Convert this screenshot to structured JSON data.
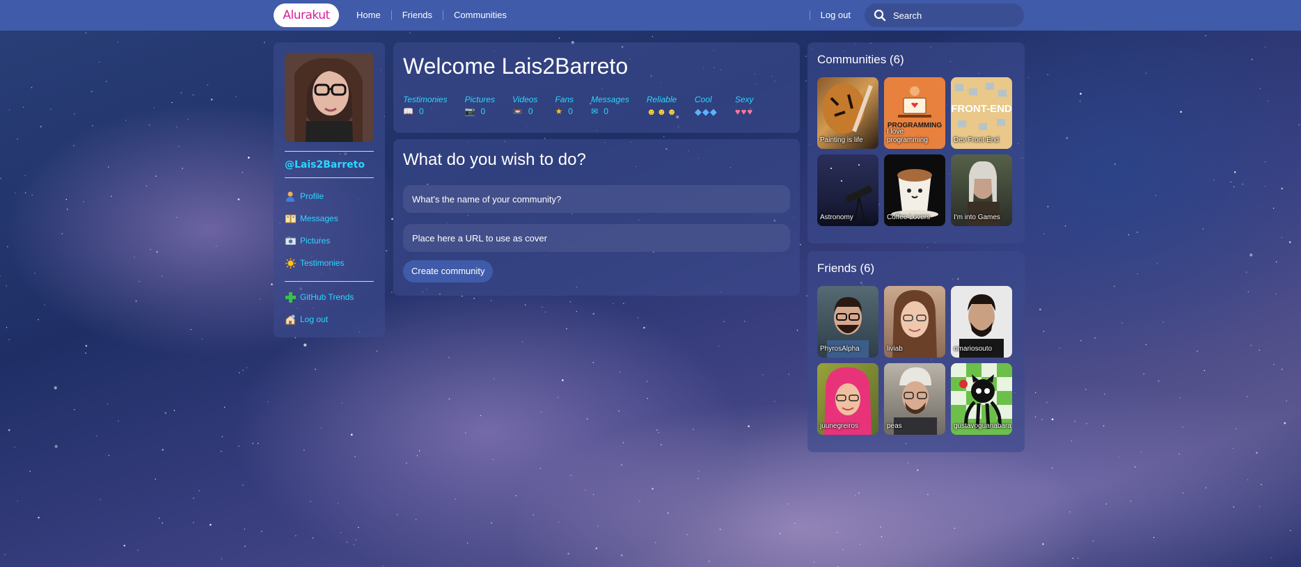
{
  "brand": {
    "logo_text": "Alurakut",
    "logo_color": "#d81d99",
    "bar_color": "#3f5ba9",
    "accent": "#2ad9ff"
  },
  "nav": {
    "home": "Home",
    "friends": "Friends",
    "communities": "Communities",
    "logout": "Log out"
  },
  "search": {
    "placeholder": "Search"
  },
  "sidebar": {
    "username": "@Lais2Barreto",
    "items": [
      {
        "label": "Profile",
        "icon": "user-icon"
      },
      {
        "label": "Messages",
        "icon": "book-icon"
      },
      {
        "label": "Pictures",
        "icon": "camera-icon"
      },
      {
        "label": "Testimonies",
        "icon": "sun-icon"
      }
    ],
    "extra": [
      {
        "label": "GitHub Trends",
        "icon": "plus-icon"
      },
      {
        "label": "Log out",
        "icon": "logout-icon"
      }
    ]
  },
  "welcome": {
    "title": "Welcome Lais2Barreto",
    "stats": [
      {
        "label": "Testimonies",
        "value": "0",
        "icon": "book-icon"
      },
      {
        "label": "Pictures",
        "value": "0",
        "icon": "camera-icon"
      },
      {
        "label": "Videos",
        "value": "0",
        "icon": "video-icon"
      },
      {
        "label": "Fans",
        "value": "0",
        "icon": "star-icon"
      },
      {
        "label": "Messages",
        "value": "0",
        "icon": "mail-icon"
      },
      {
        "label": "Reliable",
        "icon": "smiley-icon",
        "level": 3
      },
      {
        "label": "Cool",
        "icon": "ice-cube-icon",
        "level": 3
      },
      {
        "label": "Sexy",
        "icon": "heart-icon",
        "level": 3
      }
    ]
  },
  "create": {
    "title": "What do you wish to do?",
    "name_placeholder": "What's the name of your community?",
    "cover_placeholder": "Place here a URL to use as cover",
    "button": "Create community"
  },
  "communities": {
    "title": "Communities (6)",
    "items": [
      "Painting is life",
      "I love programming",
      "Dev Front-End",
      "Astronomy",
      "Coffee Lovers",
      "I'm into Games"
    ]
  },
  "friends": {
    "title": "Friends (6)",
    "items": [
      "PhyrosAlpha",
      "liviab",
      "omariosouto",
      "juunegreiros",
      "peas",
      "gustavoguanabara"
    ]
  }
}
